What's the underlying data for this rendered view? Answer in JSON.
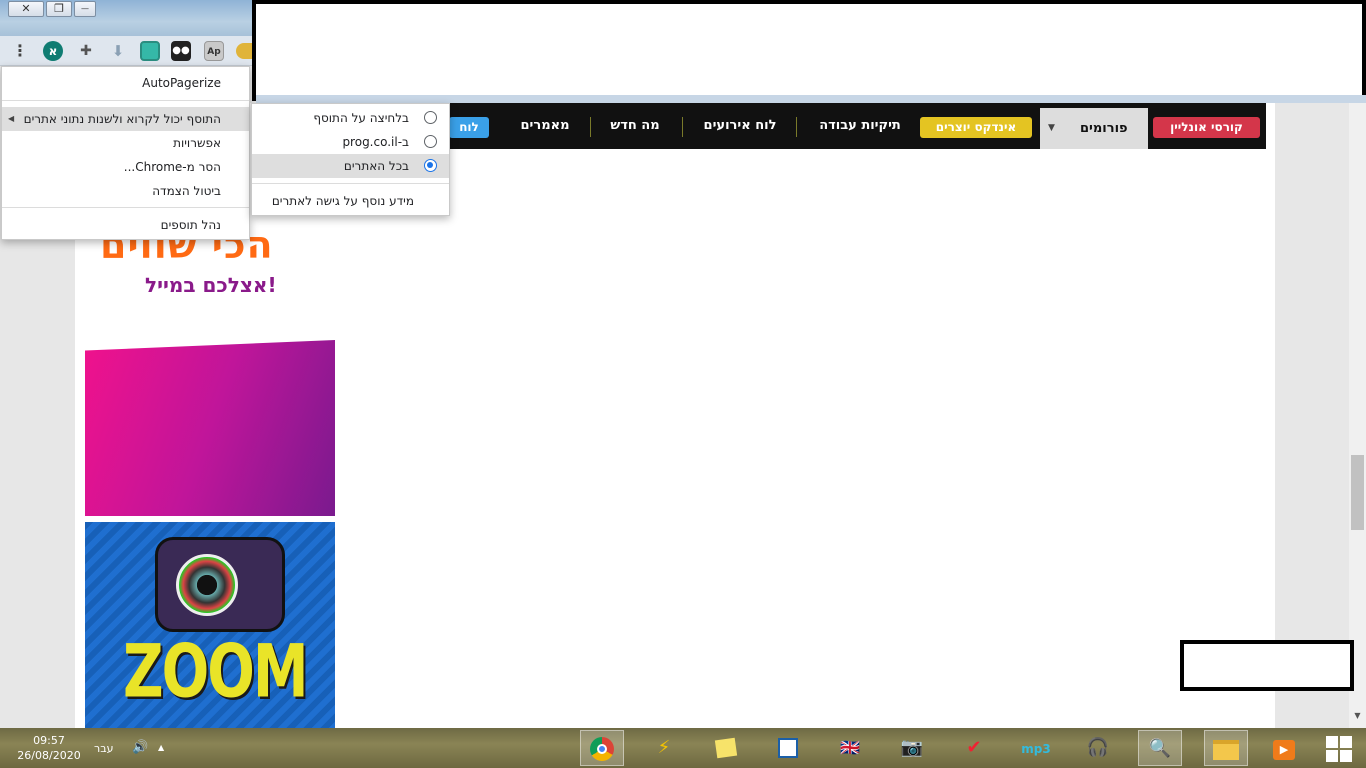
{
  "window": {
    "close_glyph": "✕",
    "restore_glyph": "❐",
    "minimize_glyph": "—"
  },
  "toolbar": {
    "menu_glyph": "⋮",
    "profile_initial": "א",
    "extensions_glyph": "✚",
    "download_glyph": "⬇",
    "ap_label": "Ap"
  },
  "nav": {
    "online_courses": "קורסי אונליין",
    "forums": "פורומים",
    "creators_index": "אינדקס יוצרים",
    "portfolios": "תיקיות עבודה",
    "events_board": "לוח אירועים",
    "whats_new": "מה חדש",
    "articles": "מאמרים",
    "board_partial": "לוח"
  },
  "extension_menu": {
    "title": "AutoPagerize",
    "site_access": "התוסף יכול לקרוא ולשנות נתוני אתרים",
    "options": "אפשרויות",
    "remove": "הסר מ-Chrome...",
    "unpin": "ביטול הצמדה",
    "manage": "נהל תוספים"
  },
  "site_access_submenu": {
    "on_click": "בלחיצה על התוסף",
    "on_site": "ב-prog.co.il",
    "all_sites": "בכל האתרים",
    "learn_more": "מידע נוסף על גישה לאתרים",
    "selected": "all_sites"
  },
  "ads": {
    "ad1_headline": "הכי שווים",
    "ad1_sub": "אצלכם במייל!",
    "ad3_headline": "ZOOM"
  },
  "taskbar": {
    "time": "09:57",
    "date": "26/08/2020",
    "language": "עבר",
    "volume_glyph": "🔊",
    "tray_up_glyph": "▲",
    "apps": [
      "chrome-icon",
      "winamp-icon",
      "sticky-notes-icon",
      "document-icon",
      "flag-app-icon",
      "camera-app-icon",
      "checkmark-app-icon",
      "mp3-app-icon",
      "audacity-icon",
      "search-app-icon",
      "file-explorer-icon",
      "media-player-icon"
    ]
  }
}
